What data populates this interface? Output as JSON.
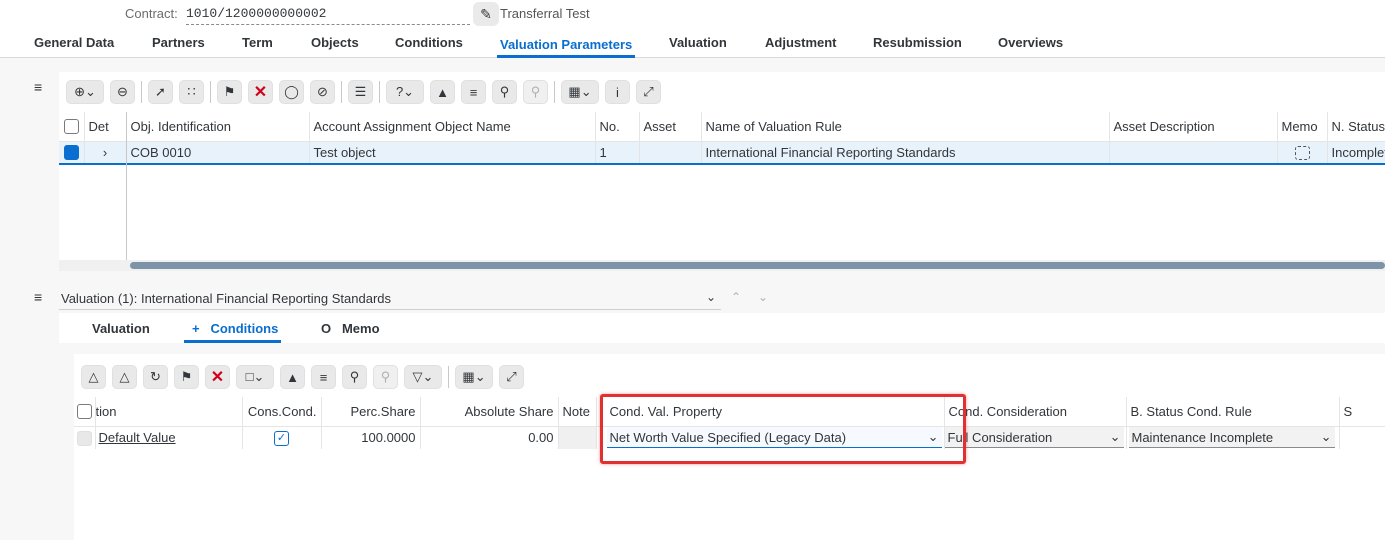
{
  "header": {
    "contract_label": "Contract:",
    "contract_value": "1010/1200000000002",
    "contract_description": "Transferral Test"
  },
  "tabs": [
    {
      "label": "General Data"
    },
    {
      "label": "Partners"
    },
    {
      "label": "Term"
    },
    {
      "label": "Objects"
    },
    {
      "label": "Conditions"
    },
    {
      "label": "Valuation Parameters",
      "active": true
    },
    {
      "label": "Valuation"
    },
    {
      "label": "Adjustment"
    },
    {
      "label": "Resubmission"
    },
    {
      "label": "Overviews"
    }
  ],
  "upper_table": {
    "columns": [
      "Det",
      "Obj. Identification",
      "Account Assignment Object Name",
      "No.",
      "Asset",
      "Name of Valuation Rule",
      "Asset Description",
      "Memo",
      "N. Status"
    ],
    "rows": [
      {
        "obj_identification": "COB 0010",
        "account_object_name": "Test object",
        "no": "1",
        "asset": "",
        "valuation_rule": "International Financial Reporting Standards",
        "asset_description": "",
        "n_status": "Incomplete"
      }
    ]
  },
  "valuation_section": {
    "title": "Valuation (1): International Financial Reporting Standards",
    "subtabs": [
      {
        "label": "Valuation",
        "prefix": ""
      },
      {
        "label": "Conditions",
        "prefix": "+",
        "active": true
      },
      {
        "label": "Memo",
        "prefix": "O"
      }
    ]
  },
  "lower_table": {
    "columns": [
      "tion",
      "Cons.Cond.",
      "Perc.Share",
      "Absolute Share",
      "Note",
      "Cond. Val. Property",
      "Cond. Consideration",
      "B. Status Cond. Rule",
      "S"
    ],
    "rows": [
      {
        "name": "Default Value",
        "cons_cond": true,
        "perc_share": "100.0000",
        "absolute_share": "0.00",
        "note": "",
        "cond_val_property": "Net Worth Value Specified (Legacy Data)",
        "cond_consideration": "Full Consideration",
        "b_status_cond_rule": "Maintenance Incomplete"
      }
    ]
  },
  "colors": {
    "accent": "#0a6ed1",
    "highlight_box": "#e03030",
    "delete_red": "#d0021b"
  }
}
